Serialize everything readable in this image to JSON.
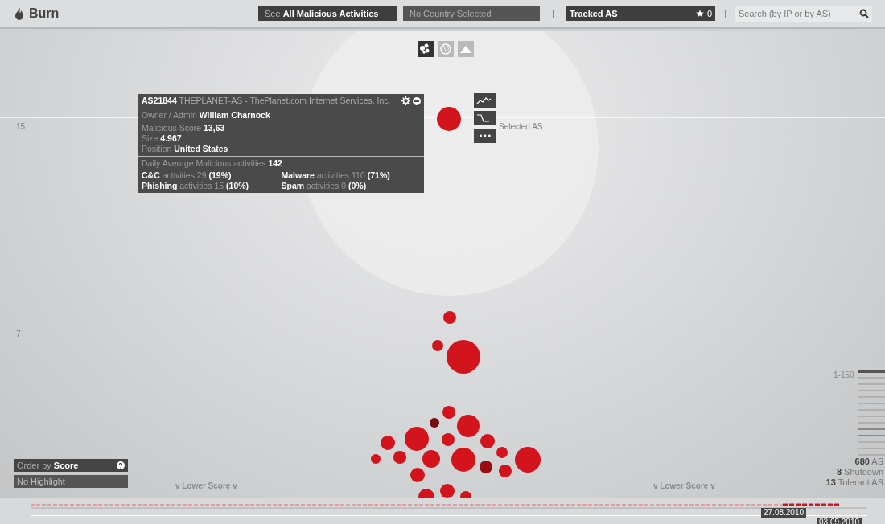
{
  "app": {
    "title": "Burn"
  },
  "topbar": {
    "activities_prefix": "See",
    "activities_label": "All Malicious Activities",
    "country": "No Country Selected",
    "tracked_label": "Tracked AS",
    "tracked_count": "0",
    "search": {
      "placeholder": "Search (by IP or by AS)"
    }
  },
  "view_toggles": [
    {
      "kind": "bubbles",
      "selected": true
    },
    {
      "kind": "globe",
      "selected": false
    },
    {
      "kind": "mountain",
      "selected": false
    }
  ],
  "axis_labels": [
    "15",
    "7"
  ],
  "selected_label": "Selected AS",
  "details": {
    "title": "**AS21844** THEPLANET-AS - ThePlanet.com Internet Services, Inc.",
    "lines": [
      "Owner / Admin **William Charnock**",
      "Malicious Score **13,63**",
      "Size **4.967**",
      "Position **United States**"
    ],
    "daily": "Daily Average Malicious activities **142**",
    "activities": [
      "**C&C** activities 29 **(19%)**",
      "**Malware** activities 110 **(71%)**",
      "**Phishing** activities 15 **(10%)**",
      "**Spam** activities 0 **(0%)**"
    ]
  },
  "chart_buttons": [
    {
      "kind": "line"
    },
    {
      "kind": "step"
    },
    {
      "kind": "more"
    }
  ],
  "bubbles": [
    {
      "color": "#d3141c"
    },
    {
      "color": "#d3141c"
    },
    {
      "color": "#d3141c"
    },
    {
      "color": "#d3141c"
    },
    {
      "color": "#d3141c"
    },
    {
      "color": "#7a0a0e"
    },
    {
      "color": "#d3141c"
    },
    {
      "color": "#d3141c"
    },
    {
      "color": "#d3141c"
    },
    {
      "color": "#d3141c"
    },
    {
      "color": "#d3141c"
    },
    {
      "color": "#d3141c"
    },
    {
      "color": "#d3141c"
    },
    {
      "color": "#d3141c"
    },
    {
      "color": "#d3141c"
    },
    {
      "color": "#d3141c"
    },
    {
      "color": "#9a0c12"
    },
    {
      "color": "#d3141c"
    },
    {
      "color": "#d3141c"
    },
    {
      "color": "#d3141c"
    },
    {
      "color": "#d3141c"
    },
    {
      "color": "#d3141c"
    },
    {
      "color": "#d3141c"
    }
  ],
  "order": {
    "prefix": "Order by",
    "value": "Score"
  },
  "highlight": "No Highlight",
  "lower_score": [
    "v Lower Score v",
    "v Lower Score v"
  ],
  "legend": {
    "range": "1-150",
    "stats": [
      "**680** AS",
      "**8** Shutdown",
      "**13** Tolerant AS"
    ]
  },
  "timeline": {
    "dates": [
      "27.08.2010",
      "03.09.2010"
    ]
  }
}
